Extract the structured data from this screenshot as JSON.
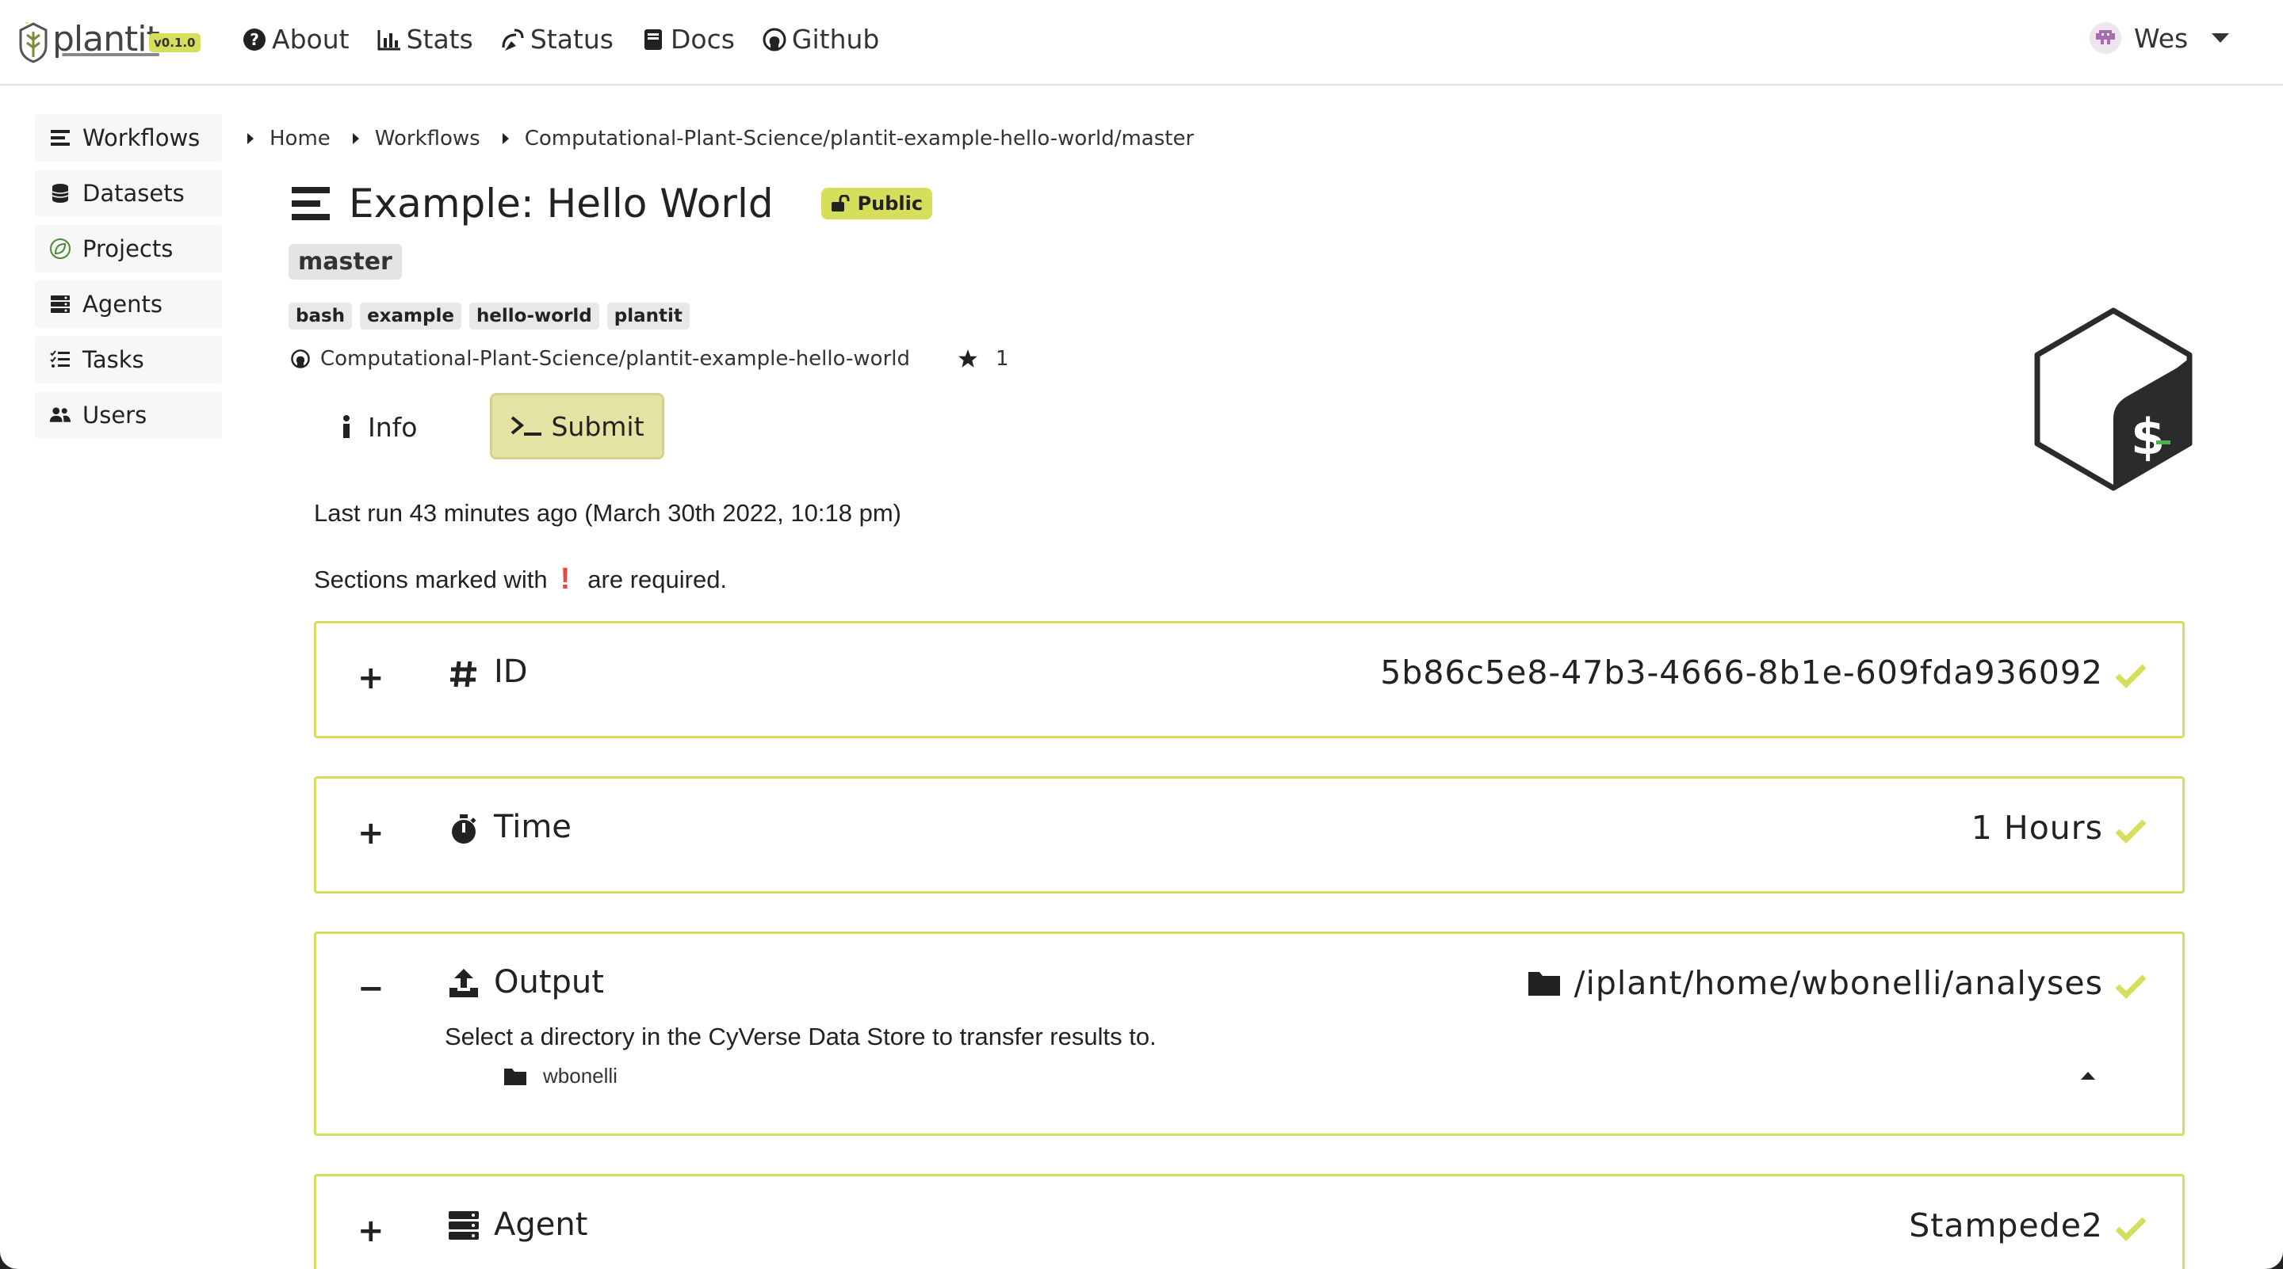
{
  "app": {
    "logo_text": "plantit",
    "version": "v0.1.0",
    "accent_color": "#d6df5c"
  },
  "nav": {
    "about": "About",
    "stats": "Stats",
    "status": "Status",
    "docs": "Docs",
    "github": "Github"
  },
  "user": {
    "name": "Wes"
  },
  "sidebar": {
    "items": [
      {
        "label": "Workflows",
        "icon": "list-icon"
      },
      {
        "label": "Datasets",
        "icon": "database-icon"
      },
      {
        "label": "Projects",
        "icon": "leaf-icon"
      },
      {
        "label": "Agents",
        "icon": "server-icon"
      },
      {
        "label": "Tasks",
        "icon": "tasks-icon"
      },
      {
        "label": "Users",
        "icon": "users-icon"
      }
    ]
  },
  "breadcrumb": {
    "home": "Home",
    "workflows": "Workflows",
    "current": "Computational-Plant-Science/plantit-example-hello-world/master"
  },
  "workflow": {
    "title": "Example: Hello World",
    "visibility": "Public",
    "branch": "master",
    "tags": [
      "bash",
      "example",
      "hello-world",
      "plantit"
    ],
    "repo": "Computational-Plant-Science/plantit-example-hello-world",
    "stars": "1"
  },
  "tabs": {
    "info": "Info",
    "submit": "Submit"
  },
  "last_run": "Last run 43 minutes ago (March 30th 2022, 10:18 pm)",
  "required_note": {
    "prefix": "Sections marked with",
    "mark": "!",
    "suffix": "are required."
  },
  "sections": {
    "id": {
      "toggle": "+",
      "label": "ID",
      "value": "5b86c5e8-47b3-4666-8b1e-609fda936092"
    },
    "time": {
      "toggle": "+",
      "label": "Time",
      "value": "1 Hours"
    },
    "output": {
      "toggle": "−",
      "label": "Output",
      "value": "/iplant/home/wbonelli/analyses",
      "description": "Select a directory in the CyVerse Data Store to transfer results to.",
      "directory": "wbonelli"
    },
    "agent": {
      "toggle": "+",
      "label": "Agent",
      "value": "Stampede2"
    }
  }
}
